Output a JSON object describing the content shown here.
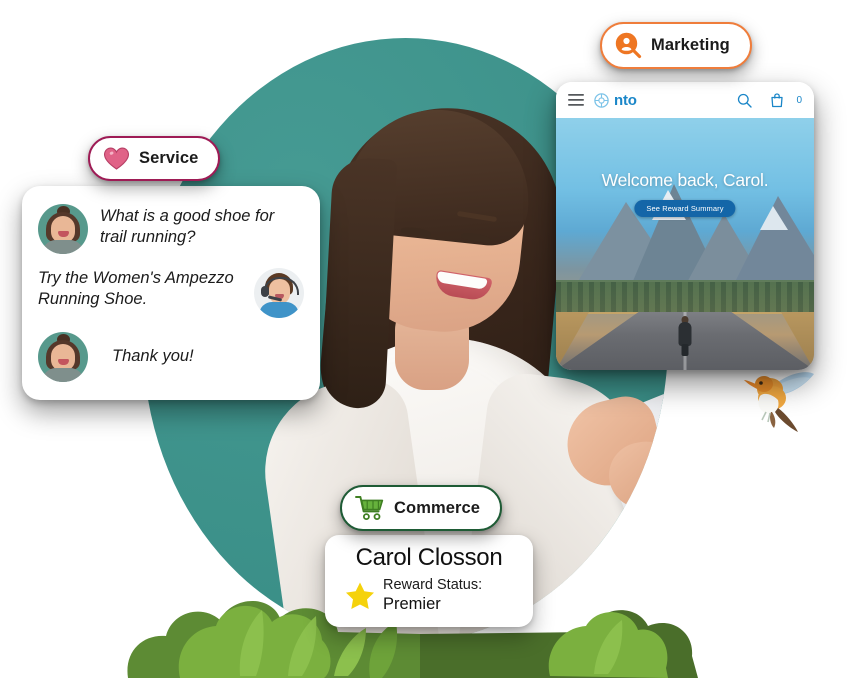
{
  "scene": {
    "title": "Customer 360 hero illustration",
    "hero_circle_color": "#3a948c",
    "background": "transparent"
  },
  "badges": [
    {
      "id": "marketing",
      "label": "Marketing",
      "icon": "customer-search-icon",
      "border_color": "#ef7d3b",
      "icon_color": "#ee7623"
    },
    {
      "id": "service",
      "label": "Service",
      "icon": "heart-icon",
      "border_color": "#9e1b55",
      "icon_color": "#e06287"
    },
    {
      "id": "commerce",
      "label": "Commerce",
      "icon": "shopping-cart-icon",
      "border_color": "#1e5b35",
      "icon_color": "#66b23c"
    }
  ],
  "chat": {
    "messages": [
      {
        "sender": "customer",
        "text": "What is a good shoe for trail running?",
        "avatar": "customer-avatar"
      },
      {
        "sender": "agent",
        "text": "Try the Women's Ampezzo Running Shoe.",
        "avatar": "agent-avatar"
      },
      {
        "sender": "customer",
        "text": "Thank you!",
        "avatar": "customer-avatar"
      }
    ]
  },
  "customer_card": {
    "name": "Carol Closson",
    "reward_label": "Reward Status:",
    "reward_value": "Premier",
    "star_icon": "star-icon",
    "star_color": "#f5d20c"
  },
  "phone": {
    "topbar": {
      "menu_icon": "hamburger-menu-icon",
      "brand": "nto",
      "brand_mark": "nto-logo-icon",
      "search_icon": "search-icon",
      "cart_icon": "shopping-bag-icon",
      "cart_count": "0",
      "accent_color": "#1a86c8"
    },
    "hero": {
      "greeting": "Welcome back, Carol.",
      "cta_label": "See Reward Summary",
      "cta_color": "#1466a8",
      "image_alt": "runner-on-mountain-road"
    }
  },
  "decor": {
    "bird": "hummingbird-icon",
    "bird_body_color": "#f0a23c",
    "bird_wing_color": "#b6d7ef",
    "foliage": "bush-foliage",
    "foliage_colors": [
      "#5d8b34",
      "#7bb03f",
      "#4a6e2a",
      "#8cc04d"
    ]
  }
}
